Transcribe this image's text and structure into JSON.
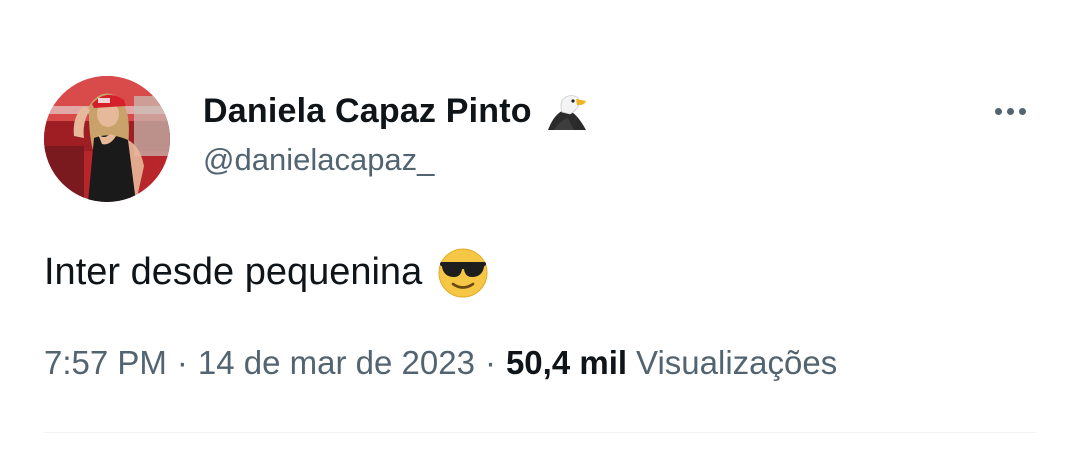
{
  "tweet": {
    "author": {
      "display_name": "Daniela Capaz Pinto",
      "badge_icon": "eagle-emoji",
      "handle": "@danielacapaz_",
      "avatar": "profile-photo"
    },
    "menu_icon": "more-horizontal-icon",
    "text": "Inter desde pequenina",
    "text_emoji": "smiling-face-with-sunglasses",
    "time": "7:57 PM",
    "separator": "·",
    "date": "14 de mar de 2023",
    "views_count": "50,4 mil",
    "views_label": "Visualizações"
  },
  "colors": {
    "primary_text": "#0f1419",
    "secondary_text": "#536471",
    "divider": "#eff3f4",
    "emoji_yellow": "#f6c744"
  }
}
